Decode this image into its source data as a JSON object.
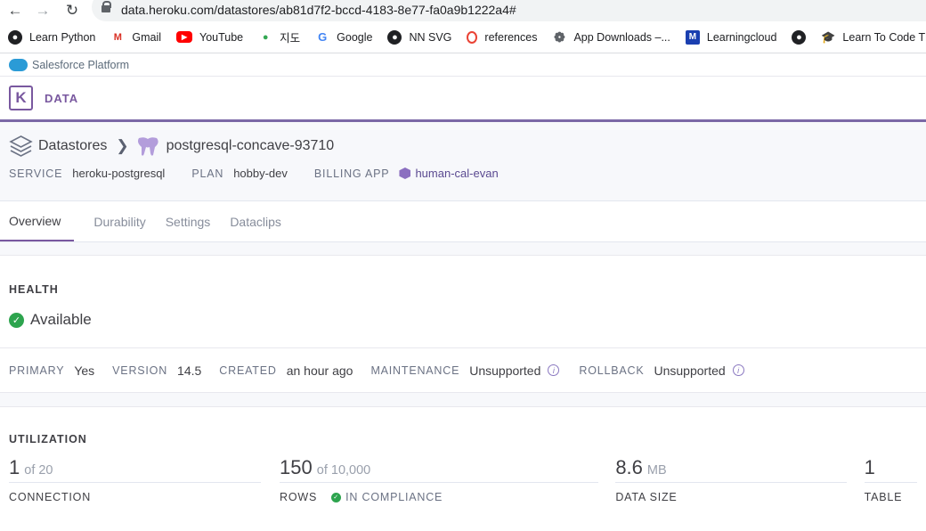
{
  "browser": {
    "url": "data.heroku.com/datastores/ab81d7f2-bccd-4183-8e77-fa0a9b1222a4#",
    "bookmarks": [
      {
        "label": "Learn Python",
        "icon": "globe-icon",
        "color": "#202124"
      },
      {
        "label": "Gmail",
        "icon": "gmail-icon",
        "color": "#d93025"
      },
      {
        "label": "YouTube",
        "icon": "youtube-icon",
        "color": "#ff0000"
      },
      {
        "label": "지도",
        "icon": "maps-icon",
        "color": "#34a853"
      },
      {
        "label": "Google",
        "icon": "google-icon",
        "color": "#4285f4"
      },
      {
        "label": "NN SVG",
        "icon": "globe-icon",
        "color": "#202124"
      },
      {
        "label": "references",
        "icon": "references-icon",
        "color": "#ea4335"
      },
      {
        "label": "App Downloads –...",
        "icon": "gear-icon",
        "color": "#5f6368"
      },
      {
        "label": "Learningcloud",
        "icon": "learningcloud-icon",
        "color": "#1a3fb0"
      },
      {
        "label": "",
        "icon": "globe-icon",
        "color": "#202124"
      },
      {
        "label": "Learn To Code The...",
        "icon": "graduation-cap-icon",
        "color": "#5f6368"
      }
    ]
  },
  "salesforce_bar": {
    "label": "Salesforce Platform"
  },
  "app_header": {
    "logo": "K",
    "label": "DATA"
  },
  "datastore": {
    "breadcrumb_root": "Datastores",
    "name": "postgresql-concave-93710",
    "meta": [
      {
        "key": "SERVICE",
        "value": "heroku-postgresql"
      },
      {
        "key": "PLAN",
        "value": "hobby-dev"
      },
      {
        "key": "BILLING APP",
        "value": "human-cal-evan"
      }
    ]
  },
  "tabs": [
    {
      "label": "Overview",
      "active": true
    },
    {
      "label": "Durability",
      "active": false
    },
    {
      "label": "Settings",
      "active": false
    },
    {
      "label": "Dataclips",
      "active": false
    }
  ],
  "health": {
    "title": "HEALTH",
    "status": "Available",
    "info": [
      {
        "key": "PRIMARY",
        "value": "Yes"
      },
      {
        "key": "VERSION",
        "value": "14.5"
      },
      {
        "key": "CREATED",
        "value": "an hour ago"
      },
      {
        "key": "MAINTENANCE",
        "value": "Unsupported"
      },
      {
        "key": "ROLLBACK",
        "value": "Unsupported"
      }
    ]
  },
  "utilization": {
    "title": "UTILIZATION",
    "metrics": [
      {
        "big": "1",
        "small": "of 20",
        "label": "CONNECTION"
      },
      {
        "big": "150",
        "small": "of 10,000",
        "label": "ROWS",
        "compliance": "IN COMPLIANCE"
      },
      {
        "big": "8.6",
        "small": "MB",
        "label": "DATA SIZE"
      },
      {
        "big": "1",
        "small": "",
        "label": "TABLE"
      }
    ]
  }
}
